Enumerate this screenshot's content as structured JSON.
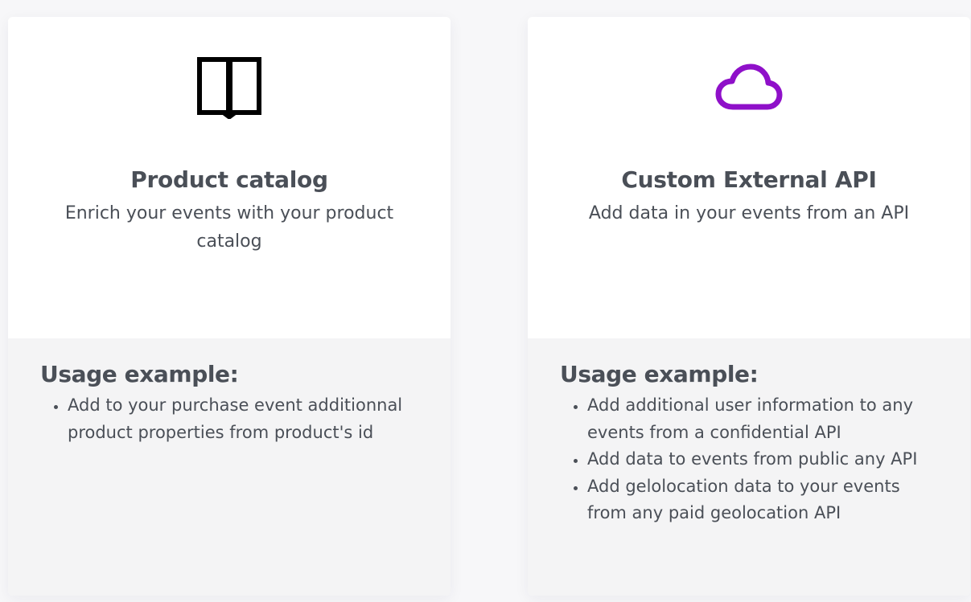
{
  "cards": [
    {
      "icon": "book-icon",
      "icon_color": "#000000",
      "title": "Product catalog",
      "description": "Enrich your events with your product catalog",
      "usage_heading": "Usage example:",
      "usage_items": [
        "Add to your purchase event additionnal product properties from product's id"
      ]
    },
    {
      "icon": "cloud-icon",
      "icon_color": "#8f10c9",
      "title": "Custom External API",
      "description": "Add data in your events from an API",
      "usage_heading": "Usage example:",
      "usage_items": [
        "Add additional user information to any events from a confidential API",
        "Add data to events from public any API",
        "Add gelolocation data to your events from any paid geolocation API"
      ]
    }
  ]
}
